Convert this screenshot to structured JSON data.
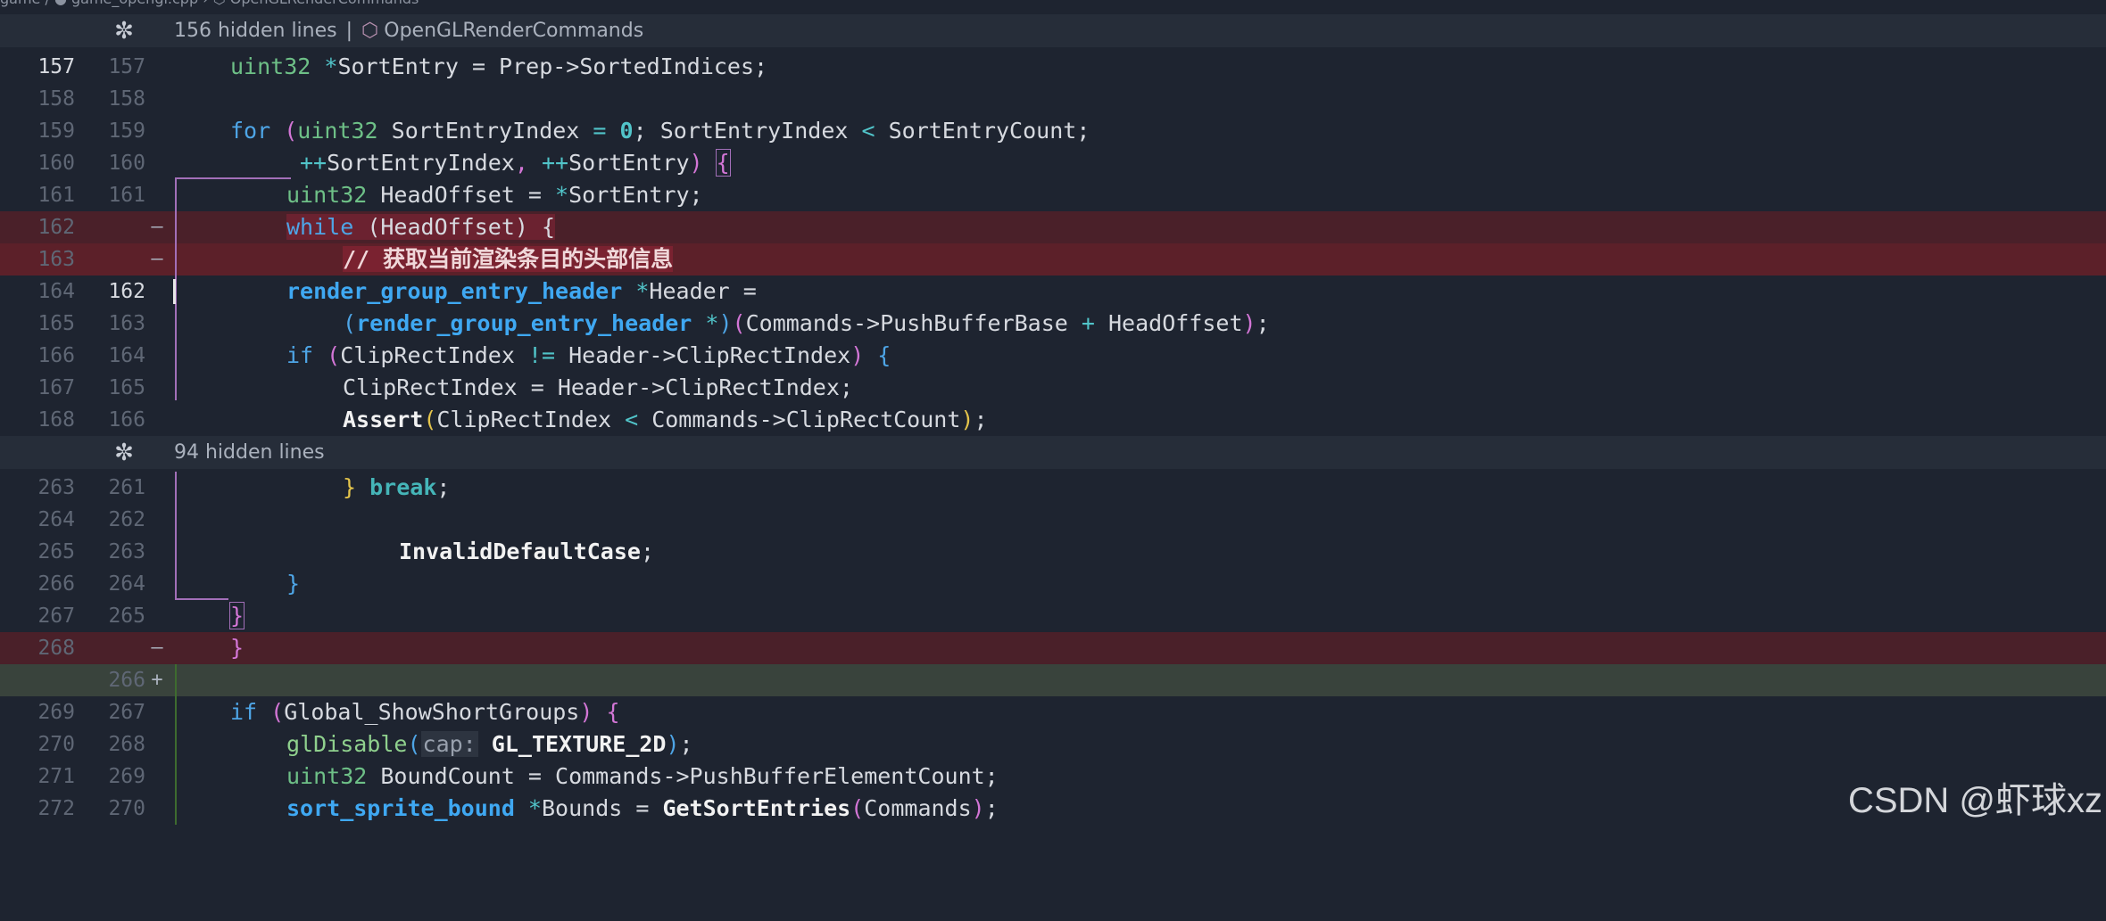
{
  "breadcrumb": "game / ● game_opengl.cpp › ⬡ OpenGLRenderCommands",
  "folds": [
    {
      "icon": "✼",
      "text": "156 hidden lines",
      "separator": "|",
      "symbol": "OpenGLRenderCommands"
    },
    {
      "icon": "✼",
      "text": "94 hidden lines"
    }
  ],
  "lines": [
    {
      "old": "157",
      "new": "157"
    },
    {
      "old": "158",
      "new": "158"
    },
    {
      "old": "159",
      "new": "159"
    },
    {
      "old": "160",
      "new": "160"
    },
    {
      "old": "161",
      "new": "161"
    },
    {
      "old": "162",
      "new": "",
      "marker": "—"
    },
    {
      "old": "163",
      "new": "",
      "marker": "—"
    },
    {
      "old": "164",
      "new": "162"
    },
    {
      "old": "165",
      "new": "163"
    },
    {
      "old": "166",
      "new": "164"
    },
    {
      "old": "167",
      "new": "165"
    },
    {
      "old": "168",
      "new": "166"
    },
    {
      "old": "263",
      "new": "261"
    },
    {
      "old": "264",
      "new": "262"
    },
    {
      "old": "265",
      "new": "263"
    },
    {
      "old": "266",
      "new": "264"
    },
    {
      "old": "267",
      "new": "265"
    },
    {
      "old": "268",
      "new": "",
      "marker": "—"
    },
    {
      "old": "",
      "new": "266",
      "marker": "+"
    },
    {
      "old": "269",
      "new": "267"
    },
    {
      "old": "270",
      "new": "268"
    },
    {
      "old": "271",
      "new": "269"
    },
    {
      "old": "272",
      "new": "270"
    }
  ],
  "code": {
    "l157": {
      "type": "uint32",
      "op": "*",
      "rest": "SortEntry = Prep->SortedIndices;"
    },
    "l159": {
      "kw": "for",
      "p": "(",
      "type": "uint32",
      "a": " SortEntryIndex ",
      "eq": "=",
      "num": "0",
      "b": "; SortEntryIndex ",
      "lt": "<",
      "c": " SortEntryCount;"
    },
    "l160": {
      "inc1": "++",
      "a": "SortEntryIndex",
      "comma": ",",
      "inc2": "++",
      "b": "SortEntry",
      "p": ")",
      "brace": "{"
    },
    "l161": {
      "type": "uint32",
      "a": " HeadOffset = ",
      "op": "*",
      "b": "SortEntry;"
    },
    "l162": {
      "kw": "while",
      "rest": " (HeadOffset) {"
    },
    "l163": {
      "comment": "// 获取当前渲染条目的头部信息"
    },
    "l164": {
      "type": "render_group_entry_header",
      "op": "*",
      "rest": "Header ="
    },
    "l165": {
      "p1": "(",
      "type": "render_group_entry_header",
      "op": " *",
      "p2": ")",
      "p3": "(",
      "a": "Commands->PushBufferBase ",
      "plus": "+",
      "b": " HeadOffset",
      "p4": ")",
      "end": ";"
    },
    "l166": {
      "kw": "if",
      "p1": " (",
      "a": "ClipRectIndex ",
      "ne": "!=",
      "b": " Header->ClipRectIndex",
      "p2": ")",
      "brace": " {"
    },
    "l167": {
      "text": "ClipRectIndex = Header->ClipRectIndex;"
    },
    "l168": {
      "fn": "Assert",
      "p1": "(",
      "a": "ClipRectIndex ",
      "lt": "<",
      "b": " Commands->ClipRectCount",
      "p2": ")",
      "end": ";"
    },
    "l261": {
      "brace": "}",
      "kw": " break",
      "end": ";"
    },
    "l263": {
      "fn": "InvalidDefaultCase",
      "end": ";"
    },
    "l264": {
      "brace": "}"
    },
    "l265": {
      "brace": "}"
    },
    "l268": {
      "brace": "}"
    },
    "l267": {
      "kw": "if",
      "p1": " (",
      "a": "Global_ShowShortGroups",
      "p2": ")",
      "brace": " {"
    },
    "l268b": {
      "fn": "glDisable",
      "p1": "(",
      "hint": "cap:",
      "arg": " GL_TEXTURE_2D",
      "p2": ")",
      "end": ";"
    },
    "l269": {
      "type": "uint32",
      "a": " BoundCount = Commands->PushBufferElementCount;"
    },
    "l270": {
      "type": "sort_sprite_bound",
      "op": " *",
      "a": "Bounds = ",
      "fn": "GetSortEntries",
      "p1": "(",
      "b": "Commands",
      "p2": ")",
      "end": ";"
    }
  },
  "watermark": "CSDN @虾球xz"
}
